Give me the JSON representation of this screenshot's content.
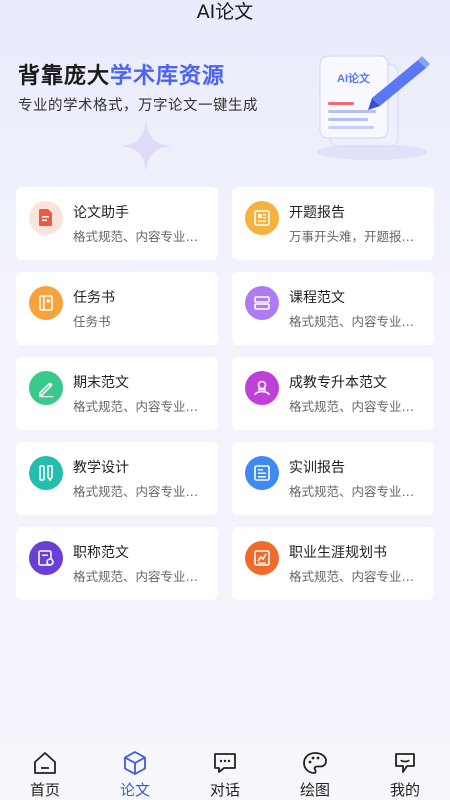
{
  "header": {
    "title": "AI论文"
  },
  "hero": {
    "title_prefix": "背靠庞大",
    "title_highlight": "学术库资源",
    "subtitle": "专业的学术格式，万字论文一键生成",
    "illustration_label": "AI论文"
  },
  "colors": {
    "accent": "#4b63f5",
    "tab_active": "#3b5bdb"
  },
  "cards": [
    {
      "title": "论文助手",
      "subtitle": "格式规范、内容专业…",
      "icon": "document-pen-icon",
      "color": "#fde3dd",
      "glyph": "#ef5a3c"
    },
    {
      "title": "开题报告",
      "subtitle": "万事开头难，开题报…",
      "icon": "newspaper-icon",
      "color": "#f6b23d",
      "glyph": "#ffffff"
    },
    {
      "title": "任务书",
      "subtitle": "任务书",
      "icon": "notebook-icon",
      "color": "#f5a33a",
      "glyph": "#ffffff"
    },
    {
      "title": "课程范文",
      "subtitle": "格式规范、内容专业…",
      "icon": "stack-icon",
      "color": "#b07bf2",
      "glyph": "#ffffff"
    },
    {
      "title": "期末范文",
      "subtitle": "格式规范、内容专业…",
      "icon": "pencil-paper-icon",
      "color": "#39c98a",
      "glyph": "#ffffff"
    },
    {
      "title": "成教专升本范文",
      "subtitle": "格式规范、内容专业…",
      "icon": "graduate-icon",
      "color": "#c03fd8",
      "glyph": "#ffffff"
    },
    {
      "title": "教学设计",
      "subtitle": "格式规范、内容专业…",
      "icon": "ruler-pencil-icon",
      "color": "#22bfae",
      "glyph": "#ffffff"
    },
    {
      "title": "实训报告",
      "subtitle": "格式规范、内容专业…",
      "icon": "report-icon",
      "color": "#3d8bf0",
      "glyph": "#ffffff"
    },
    {
      "title": "职称范文",
      "subtitle": "格式规范、内容专业…",
      "icon": "certificate-icon",
      "color": "#6a3fd8",
      "glyph": "#ffffff"
    },
    {
      "title": "职业生涯规划书",
      "subtitle": "格式规范、内容专业…",
      "icon": "career-icon",
      "color": "#f06a2a",
      "glyph": "#ffffff"
    }
  ],
  "tabs": [
    {
      "label": "首页",
      "icon": "home-icon",
      "active": false
    },
    {
      "label": "论文",
      "icon": "cube-icon",
      "active": true
    },
    {
      "label": "对话",
      "icon": "chat-icon",
      "active": false
    },
    {
      "label": "绘图",
      "icon": "palette-icon",
      "active": false
    },
    {
      "label": "我的",
      "icon": "profile-icon",
      "active": false
    }
  ]
}
